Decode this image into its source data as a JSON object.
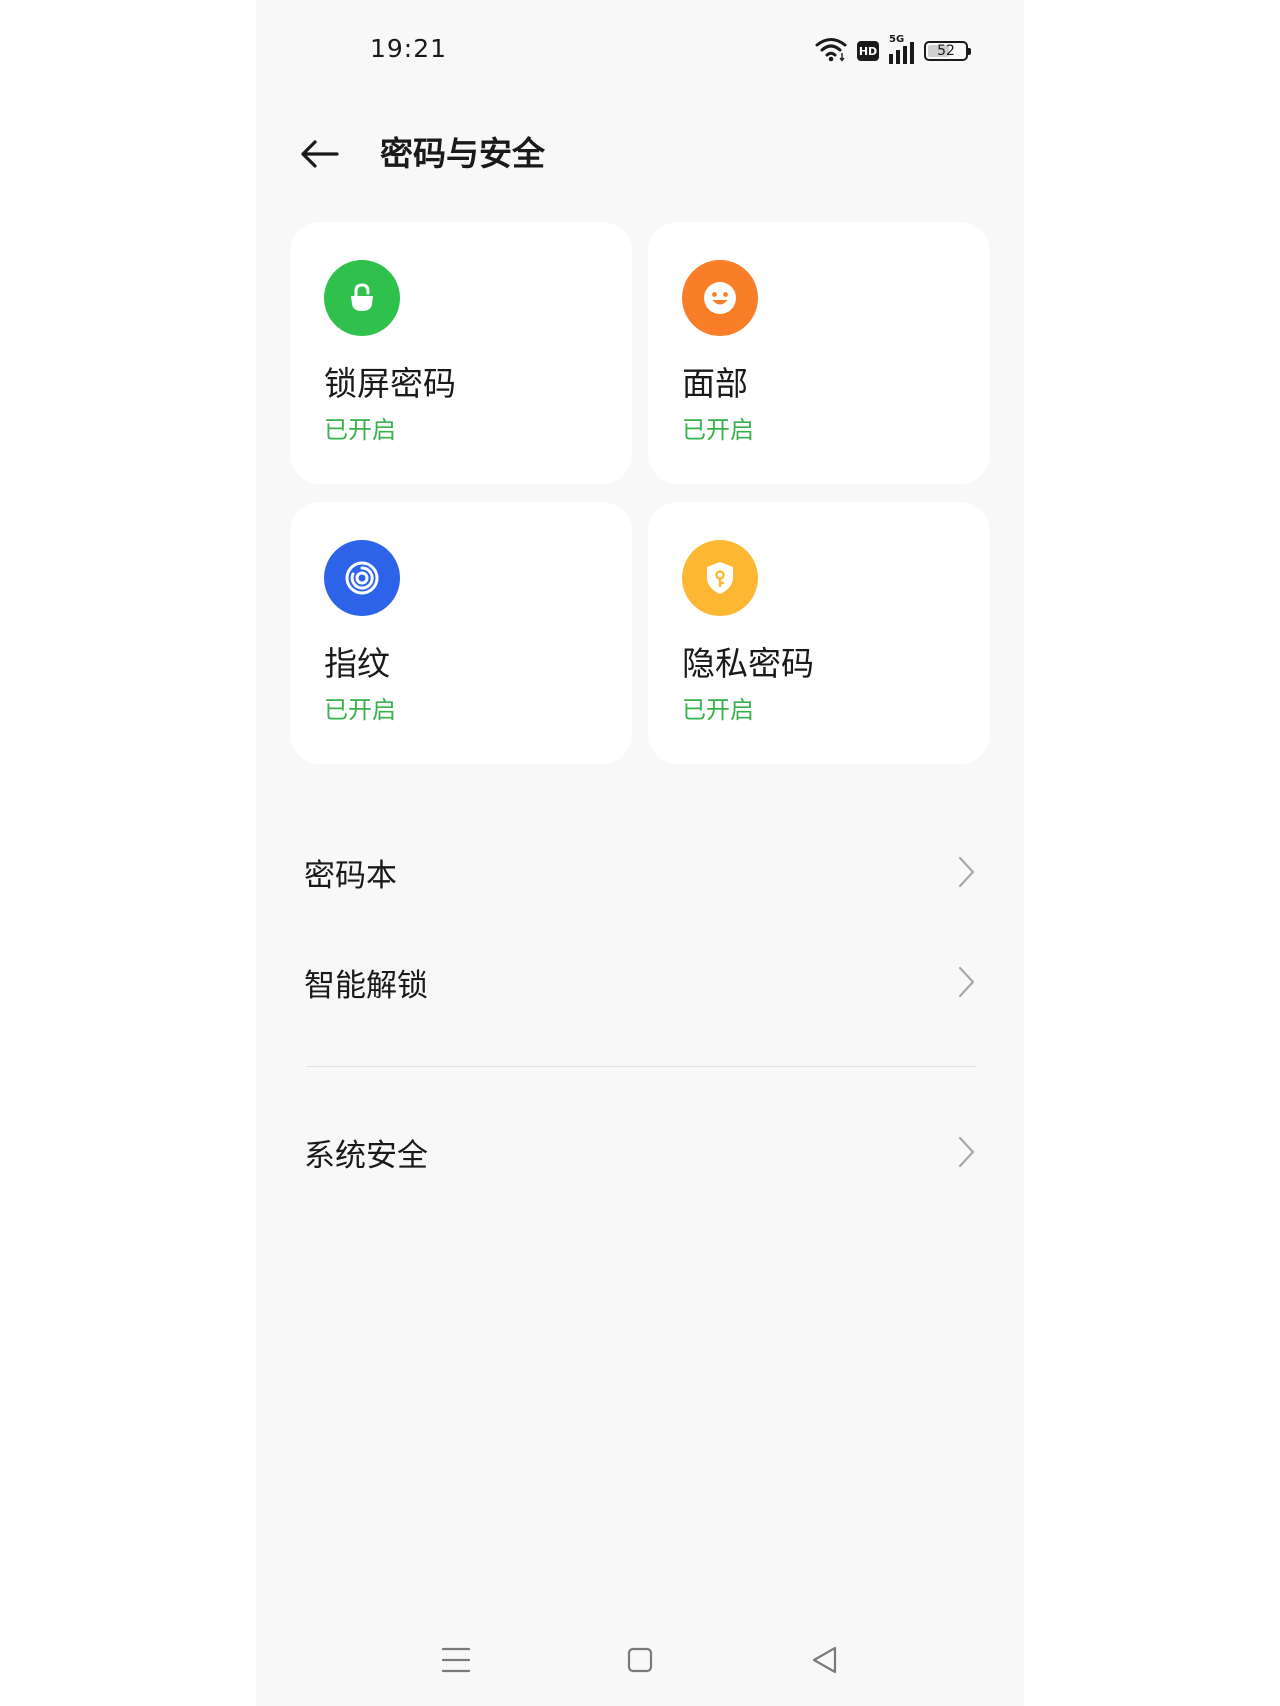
{
  "status_bar": {
    "time": "19:21",
    "network": "5G",
    "hd_label": "HD",
    "battery_level": "52"
  },
  "header": {
    "title": "密码与安全"
  },
  "cards": [
    {
      "title": "锁屏密码",
      "status": "已开启",
      "icon": "lock-icon",
      "color": "#2fc14c"
    },
    {
      "title": "面部",
      "status": "已开启",
      "icon": "face-icon",
      "color": "#fa7d28"
    },
    {
      "title": "指纹",
      "status": "已开启",
      "icon": "fingerprint-icon",
      "color": "#2d63e8"
    },
    {
      "title": "隐私密码",
      "status": "已开启",
      "icon": "shield-key-icon",
      "color": "#fdb733"
    }
  ],
  "list": {
    "items": [
      {
        "label": "密码本"
      },
      {
        "label": "智能解锁"
      },
      {
        "label": "系统安全"
      }
    ]
  },
  "colors": {
    "status_green": "#37b24d",
    "background": "#f8f8f8",
    "card": "#ffffff"
  }
}
